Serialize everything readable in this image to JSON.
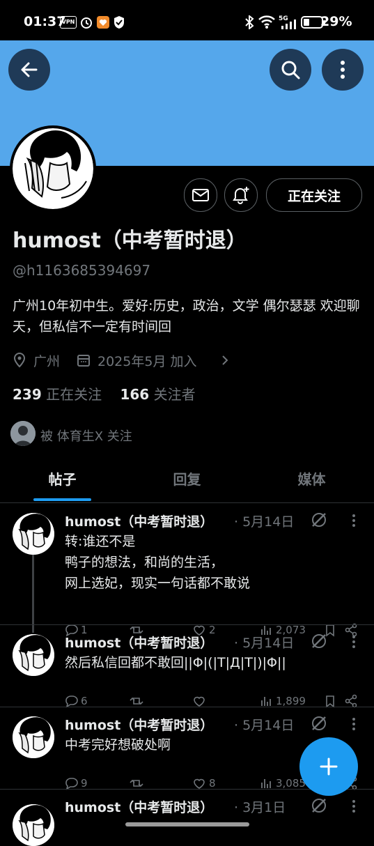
{
  "status_bar": {
    "time": "01:37",
    "vpn": "VPN",
    "network": "5G",
    "battery": "29%"
  },
  "profile": {
    "display_name": "humost（中考暂时退）",
    "handle": "@h1163685394697",
    "bio": "广州10年初中生。爱好:历史，政治，文学 偶尔瑟瑟 欢迎聊天，但私信不一定有时间回",
    "location": "广州",
    "joined": "2025年5月 加入",
    "following_count": "239",
    "following_label": "正在关注",
    "followers_count": "166",
    "followers_label": "关注者",
    "followed_by": "被 体育生X 关注",
    "follow_button": "正在关注"
  },
  "tabs": [
    {
      "label": "帖子",
      "active": true
    },
    {
      "label": "回复",
      "active": false
    },
    {
      "label": "媒体",
      "active": false
    }
  ],
  "posts": [
    {
      "name": "humost（中考暂时退）",
      "date": "· 5月14日",
      "lines": [
        "转:谁还不是",
        "鸭子的想法，和尚的生活，",
        "网上选妃，现实一句话都不敢说"
      ],
      "replies": "1",
      "retweets": "",
      "likes": "2",
      "views": "2,073"
    },
    {
      "name": "humost（中考暂时退）",
      "date": "· 5月14日",
      "lines": [
        "然后私信回都不敢回||Φ|(|T|Д|T|)|Φ||"
      ],
      "replies": "6",
      "retweets": "",
      "likes": "",
      "views": "1,899"
    },
    {
      "name": "humost（中考暂时退）",
      "date": "· 5月14日",
      "lines": [
        "中考完好想破处啊"
      ],
      "replies": "9",
      "retweets": "",
      "likes": "8",
      "views": "3,085"
    },
    {
      "name": "humost（中考暂时退）",
      "date": "· 3月1日",
      "lines": [],
      "replies": "",
      "retweets": "",
      "likes": "",
      "views": ""
    }
  ],
  "icons": {
    "back": "back-arrow-icon",
    "search": "search-icon",
    "more": "more-vertical-icon",
    "message": "envelope-icon",
    "notify": "bell-plus-icon",
    "location": "location-pin-icon",
    "calendar": "calendar-icon",
    "compose": "plus-icon"
  },
  "colors": {
    "banner": "#55a7eb",
    "accent": "#1d9bf0",
    "background": "#000000",
    "muted": "#71767b"
  }
}
